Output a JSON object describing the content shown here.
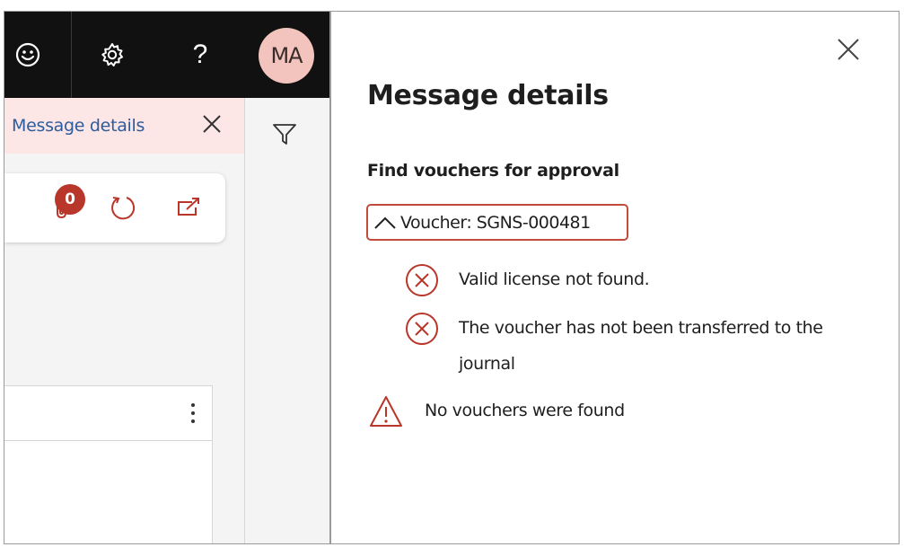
{
  "header": {
    "feedback_icon": "smiley-icon",
    "settings_icon": "gear-icon",
    "help_label": "?",
    "avatar_initials": "MA"
  },
  "message_bar": {
    "link_label": "Message details",
    "close_icon": "close-icon"
  },
  "toolbar": {
    "attachments_badge": "0",
    "attachments_icon": "paperclip-icon",
    "refresh_icon": "refresh-icon",
    "open_new_icon": "open-in-new-icon"
  },
  "grid": {
    "more_icon": "vertical-ellipsis-icon"
  },
  "filter": {
    "icon": "filter-icon"
  },
  "panel": {
    "title": "Message details",
    "section_title": "Find vouchers for approval",
    "voucher_label": "Voucher: SGNS-000481",
    "errors": [
      {
        "text": "Valid license not found."
      },
      {
        "text": "The voucher has not been transferred to the journal"
      }
    ],
    "warning": "No vouchers were found"
  },
  "colors": {
    "topbar": "#111111",
    "avatar_bg": "#f2c4bd",
    "message_bar_bg": "#fde6e6",
    "link": "#2c5c9e",
    "error_red": "#b8362a",
    "badge": "#b8362a"
  }
}
